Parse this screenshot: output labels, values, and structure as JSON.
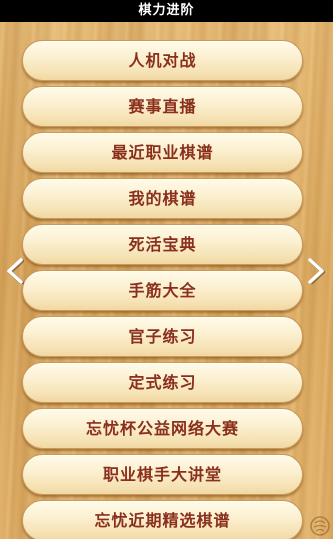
{
  "header": {
    "title": "棋力进阶"
  },
  "menu": {
    "items": [
      {
        "label": "人机对战"
      },
      {
        "label": "赛事直播"
      },
      {
        "label": "最近职业棋谱"
      },
      {
        "label": "我的棋谱"
      },
      {
        "label": "死活宝典"
      },
      {
        "label": "手筋大全"
      },
      {
        "label": "官子练习"
      },
      {
        "label": "定式练习"
      },
      {
        "label": "忘忧杯公益网络大赛"
      },
      {
        "label": "职业棋手大讲堂"
      },
      {
        "label": "忘忧近期精选棋谱"
      }
    ]
  },
  "nav": {
    "prev_icon": "chevron-left-icon",
    "next_icon": "chevron-right-icon"
  },
  "colors": {
    "title_bar": "#000000",
    "wood": "#dcab63",
    "button_face": "#fbefcf",
    "button_text": "#8a2f1c",
    "arrow": "#ffffff"
  }
}
